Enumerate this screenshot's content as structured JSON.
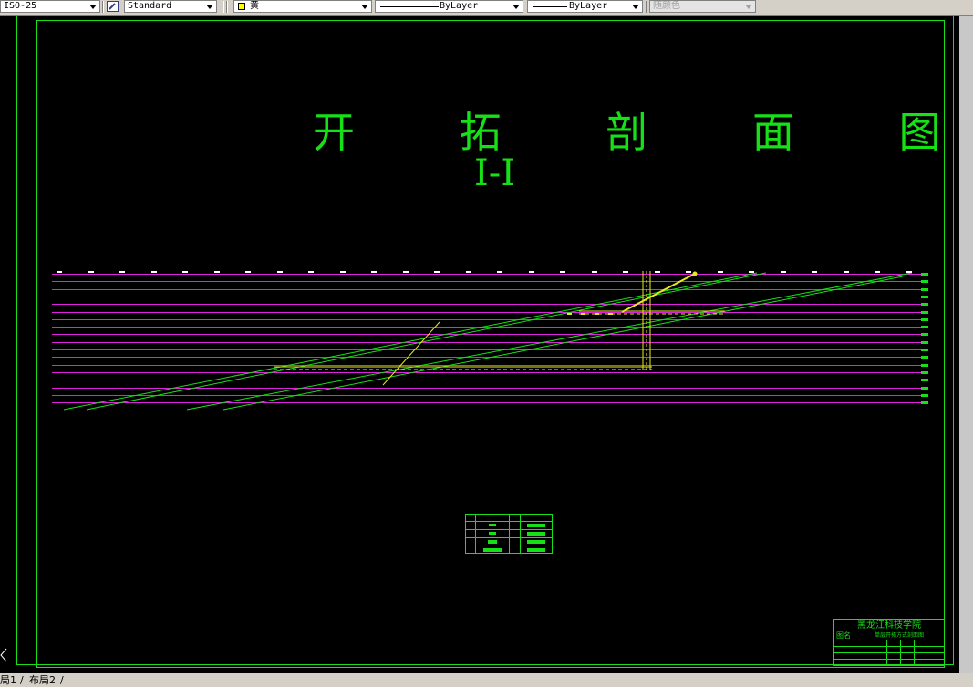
{
  "toolbar": {
    "dimstyle": "ISO-25",
    "textstyle": "Standard",
    "color": "黄",
    "linetype": "ByLayer",
    "lineweight": "ByLayer",
    "plotstyle": "随颜色"
  },
  "drawing": {
    "title": "开 拓 剖 面 图",
    "subtitle": "I-I"
  },
  "title_block": {
    "school": "黑龙江科技学院",
    "drawing_label": "图名",
    "drawing_name": "单层开拓方式剖面图"
  },
  "layout_tabs": [
    "局1",
    "布局2"
  ],
  "colors": {
    "level_line": "#e020e0",
    "seam": "#16e016",
    "workings": "#e8e820",
    "border": "#16e016"
  },
  "icons": [
    "dimstyle-icon",
    "textstyle-icon",
    "yellow-swatch",
    "scroll-left-icon"
  ]
}
